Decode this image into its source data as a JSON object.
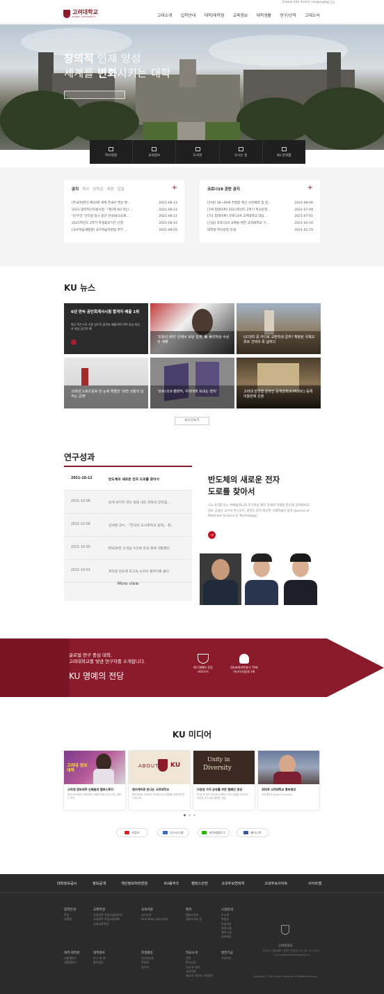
{
  "util": {
    "global": "Global Site",
    "lang": "Select Language",
    "login": "로그인"
  },
  "header": {
    "logo_kr": "고려대학교",
    "logo_en": "KOREA UNIVERSITY",
    "nav": [
      "고대소개",
      "입학안내",
      "대학/대학원",
      "교육정보",
      "대학생활",
      "연구/산학",
      "고대소식"
    ]
  },
  "hero": {
    "line1_bold": "창의적",
    "line1_rest": " 인재 양성",
    "line2_a": "세계를 ",
    "line2_b": "변화",
    "line2_c": "시키는 대학"
  },
  "quick": [
    "학사일정",
    "교육정보",
    "도서관",
    "오시는 길",
    "KU 문의함"
  ],
  "notice": {
    "tabs": [
      "공지",
      "학사",
      "장학금",
      "채용",
      "입찰"
    ],
    "plus": "+",
    "rows": [
      {
        "t": "[한국어센터] 제20회 세계 한국어 영상 편...",
        "d": "2021-08-13"
      },
      {
        "t": "2021 대학혁신지원사업 「제7회 KU 혁신...",
        "d": "2021-08-12"
      },
      {
        "t": "'유/무선' 인터넷 일시 중단 안내(8/14(토...",
        "d": "2021-08-11"
      },
      {
        "t": "2021학년도 2학기 학생휴보기간 신청",
        "d": "2021-08-10"
      },
      {
        "t": "[교수학습개발원] 교수학습지원팀 학부 ...",
        "d": "2021-08-05"
      }
    ]
  },
  "covid": {
    "title": "코로나19 관련 공지",
    "plus": "+",
    "rows": [
      {
        "t": "[안내] 18~49세 연령층 백신 사전예약 및 접...",
        "d": "2021-08-06"
      },
      {
        "t": "[7/9 업데이트] 2021학년도 2학기 학사운영...",
        "d": "2021-07-09"
      },
      {
        "t": "[7/1 업데이트] 코로나19 고려대학교 대응 ...",
        "d": "2021-07-01"
      },
      {
        "t": "[긴급] 코로나19 극복을 위한 고려대학교 구...",
        "d": "2021-04-16"
      },
      {
        "t": "대학원 학사일정 안내",
        "d": "2021-02-25"
      }
    ]
  },
  "kunews": {
    "title": "KU 뉴스",
    "items": [
      {
        "cap": "6년 연속 공인회계사시험 합격자 배출 1위",
        "sub": "최근 5년 누적 기준 압도적 합격자 배출하며 CPA 양성 최강자 위상 굳건히 해"
      },
      {
        "cap": "'조용의 머리' 안에서 보낸 일생, 美 플리처상 수상 의 새해"
      },
      {
        "cap": "UC대학 중 어디로 교환학생 갈까? 확장된 국제교류로 선택의 폭 넓혀다"
      },
      {
        "cap": "고려대 스포츠문화 한 눈에 특별전 '보면 것들이 남겨는 곳에'"
      },
      {
        "cap": "'코로나19 팬데믹, 우리에게 보내는 편지'"
      },
      {
        "cap": "고려대 한국형 온라인 공개강좌(K-MOOC) 등록 이틀만에 선정"
      }
    ],
    "more": "뉴스더보기"
  },
  "research": {
    "title": "연구성과",
    "rows": [
      {
        "d": "2021-10-12",
        "t": "반도체의 새로운 전자 도로를 찾아서"
      },
      {
        "d": "2021-10-06",
        "t": "눈에 보이지 않는 빛을 내는 자독성 양자점..."
      },
      {
        "d": "2021-10-06",
        "t": "김세환 교수, 「한국의 도시계획과 설계」 출..."
      },
      {
        "d": "2021-10-05",
        "t": "ESG위한 신개념 수전에 한국 축에 개발했다"
      },
      {
        "d": "2021-10-01",
        "t": "위자층 반도체 초고속 소자의 돌파리를 풀다"
      }
    ],
    "more": "More view",
    "feature_title1": "반도체의 새로운 전자",
    "feature_title2": "도로를 찾아서",
    "feature_desc": "나노과기를 포는 루빠들(RL)의 전기특성 제작 차세대 미래형 반도체 공학에서의 정보 공생산 교수와 연구교수, 광학도 분야 최상위 국제학술지 실려 (Journal of Materials Science & Technology)",
    "btn": "→"
  },
  "banner": {
    "line1": "글로벌 연구 중심 대학,",
    "line2": "고려대학교를 빛낸 연구자를 소개합니다.",
    "big": "KU 명예의 전당",
    "items": [
      {
        "t1": "KU 명예의 전당",
        "t2": "바로가기"
      },
      {
        "t1": "QS세계대학평가 74위",
        "t2": "아시아사립대 1위"
      }
    ]
  },
  "media": {
    "title": "KU 미디어",
    "items": [
      {
        "t": "고려대 정보대학 신혜원의 캠퍼스투어",
        "d": "한교고려대학교 정보대학 신혜원 학생 3인이 하는 캠퍼스 투어"
      },
      {
        "t": "맨즈케치로 만나는 고려대학교",
        "d": "맨즈케치로 고려대의 역사와 로고 변화를 간략하게 만나보아요!"
      },
      {
        "t": "다양성 가치 공유를 위한 캠페인 영상",
        "d": "한 명 한 명이 우리에 존재하는 의미 있음을 보여주는 다양성 가치 공유 캠페인 영상"
      },
      {
        "t": "2020 고려대학교 홍보영상",
        "d": "고려대학교 Korea University"
      }
    ],
    "thumb_texts": {
      "m1": "고려대 정보대학",
      "m2a": "ABOUT",
      "m2b": "KU",
      "m3a": "Unity in",
      "m3b": "Diversity"
    }
  },
  "sns": [
    "유튜브",
    "인스타그램",
    "네이버블로그",
    "페이스북"
  ],
  "footer": {
    "links": [
      "대학정보공시",
      "정보공개",
      "개인정보처리방침",
      "KU옴부즈",
      "캠퍼스안전",
      "고내주요연락처",
      "고내주요사이트",
      "사이트맵"
    ],
    "cols": [
      {
        "h": "입학안내",
        "i": [
          "학부",
          "대학원"
        ]
      },
      {
        "h": "교환학생",
        "i": [
          "국내대학 학점교류(OUT)",
          "국내대학 학점교류(IN)",
          "국제교환학생"
        ]
      },
      {
        "h": "교육지원",
        "i": [
          "사이교육",
          "One-Stop 서비스센터"
        ]
      },
      {
        "h": "편의",
        "i": [
          "캠퍼스투어",
          "캠퍼스지도 등"
        ]
      },
      {
        "h": "시설안내",
        "i": [
          "도서관",
          "박물관",
          "학생식당",
          "편의시설",
          "체육시설",
          "정보제공"
        ]
      },
      {
        "h": "대학·대학원",
        "i": [
          "서울캠퍼스",
          "세종캠퍼스"
        ]
      },
      {
        "h": "대학홍보",
        "i": [
          "로고 및 UI",
          "홍보영상"
        ]
      },
      {
        "h": "학생활동",
        "i": [
          "자유발사진",
          "학생회",
          "동아리"
        ]
      },
      {
        "h": "학교소개",
        "i": [
          "연혁",
          "학교상징",
          "국내·외 평가",
          "교육목표",
          "재교의 의무와 고대정신"
        ]
      },
      {
        "h": "발전기금",
        "i": [
          "기부하기"
        ]
      }
    ],
    "logo": "고려대학교",
    "addr": "02841 서울특별시 성북구 안암로 145 TEL 02-3290-1114 webmaster@korea.ac.kr",
    "copy": "Copyright ⓒ 2007 Korea University. All Rights Reserved"
  },
  "colors": {
    "crimson": "#8b1a2b",
    "dark": "#1f1f1f",
    "footer": "#2b2b2b"
  }
}
